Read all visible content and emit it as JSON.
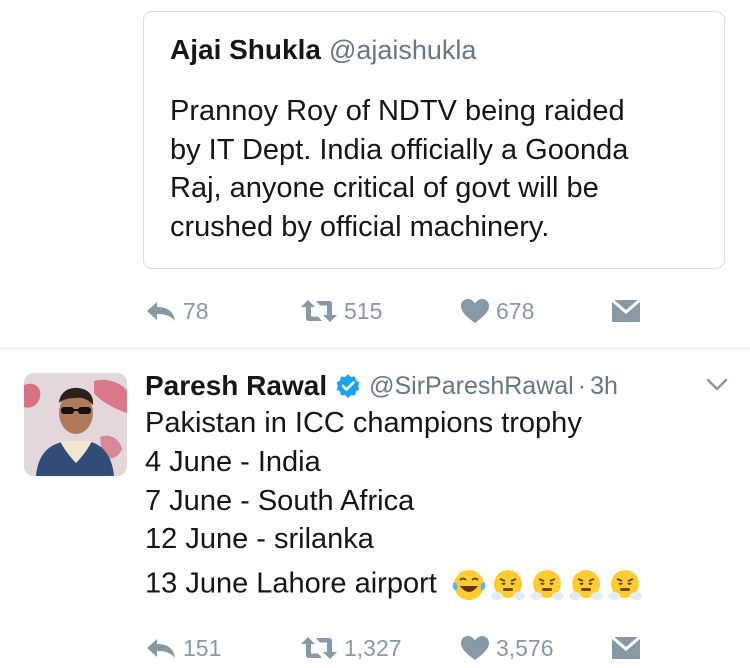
{
  "quoted_tweet": {
    "name": "Ajai Shukla",
    "handle": "@ajaishukla",
    "text_lines": [
      "Prannoy Roy of NDTV being raided",
      "by IT Dept. India officially a Goonda",
      "Raj, anyone critical of govt will be",
      "crushed by official machinery."
    ]
  },
  "actions_1": {
    "reply_count": "78",
    "retweet_count": "515",
    "like_count": "678"
  },
  "tweet": {
    "name": "Paresh Rawal",
    "handle": "@SirPareshRawal",
    "separator": "·",
    "time": "3h",
    "lines": [
      "Pakistan in ICC champions trophy",
      "4 June - India",
      "7 June - South Africa",
      "12 June - srilanka",
      "13 June Lahore airport"
    ],
    "emojis": [
      "face-with-tears-of-joy",
      "face-with-steam",
      "face-with-steam",
      "face-with-steam",
      "face-with-steam"
    ]
  },
  "actions_2": {
    "reply_count": "151",
    "retweet_count": "1,327",
    "like_count": "3,576"
  },
  "colors": {
    "text": "#14171a",
    "secondary": "#657786",
    "action_gray": "#8899a6",
    "verified_blue": "#1da1f2",
    "border": "#d8dee3"
  }
}
